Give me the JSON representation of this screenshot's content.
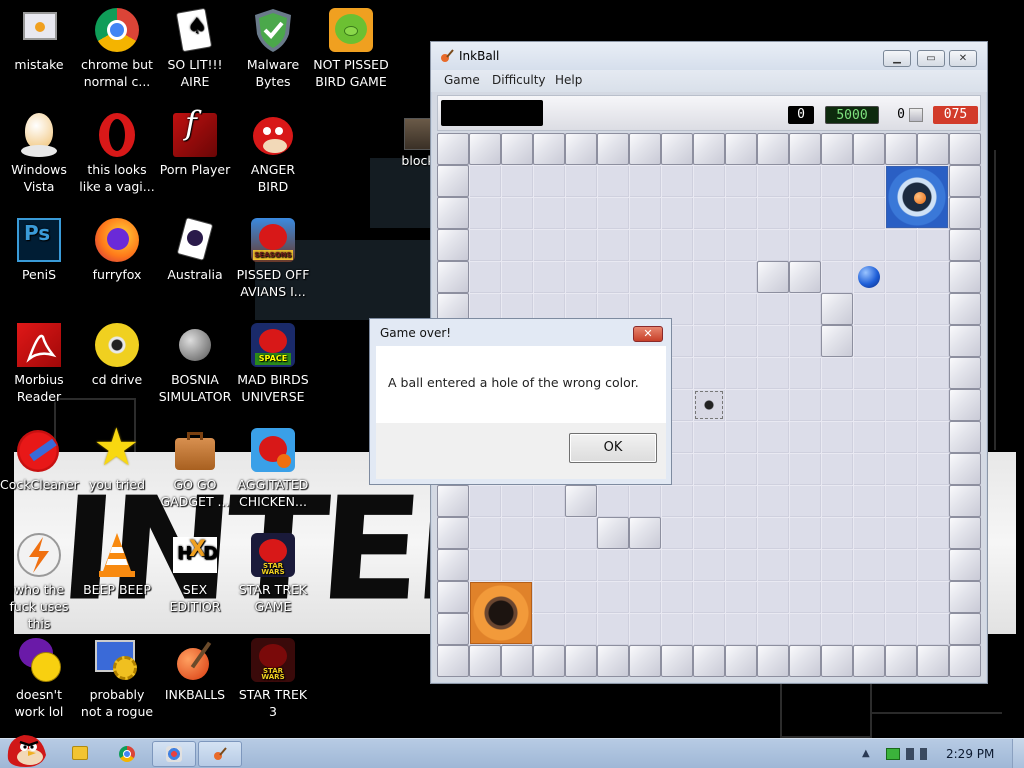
{
  "desktop": {
    "icons": [
      {
        "label": "mistake",
        "icon": "computer-icon"
      },
      {
        "label": "chrome but normal c...",
        "icon": "chrome-icon"
      },
      {
        "label": "SO LIT!!! AIRE",
        "icon": "solitaire-icon"
      },
      {
        "label": "Malware Bytes",
        "icon": "shield-icon"
      },
      {
        "label": "NOT PISSED BIRD GAME",
        "icon": "green-pig-icon"
      },
      {
        "label": "Windows Vista",
        "icon": "egg-icon"
      },
      {
        "label": "this looks like a vagi...",
        "icon": "opera-icon"
      },
      {
        "label": "Porn Player",
        "icon": "flash-icon"
      },
      {
        "label": "ANGER BIRD",
        "icon": "red-bird-icon"
      },
      {
        "label": "PeniS",
        "icon": "photoshop-icon"
      },
      {
        "label": "furryfox",
        "icon": "firefox-icon"
      },
      {
        "label": "Australia",
        "icon": "spider-solitaire-icon"
      },
      {
        "label": "PISSED OFF AVIANS I...",
        "icon": "angry-birds-seasons-icon"
      },
      {
        "label": "Morbius Reader",
        "icon": "acrobat-icon"
      },
      {
        "label": "cd drive",
        "icon": "cd-icon"
      },
      {
        "label": "BOSNIA SIMULATOR",
        "icon": "mine-icon"
      },
      {
        "label": "MAD BIRDS UNIVERSE",
        "icon": "angry-birds-space-icon"
      },
      {
        "label": "CockCleaner",
        "icon": "ccleaner-icon"
      },
      {
        "label": "you tried",
        "icon": "star-icon"
      },
      {
        "label": "GO GO GADGET ...",
        "icon": "briefcase-icon"
      },
      {
        "label": "AGGITATED CHICKEN...",
        "icon": "angry-birds-rio-icon"
      },
      {
        "label": "who the fuck uses this",
        "icon": "lightning-icon"
      },
      {
        "label": "BEEP BEEP",
        "icon": "vlc-cone-icon"
      },
      {
        "label": "SEX EDITIOR",
        "icon": "hxd-icon"
      },
      {
        "label": "STAR TREK GAME",
        "icon": "star-wars-birds-icon"
      },
      {
        "label": "doesn't work lol",
        "icon": "yahoo-messenger-icon"
      },
      {
        "label": "probably not a rogue",
        "icon": "gear-monitor-icon"
      },
      {
        "label": "INKBALLS",
        "icon": "inkball-icon"
      },
      {
        "label": "STAR TREK 3",
        "icon": "star-wars-birds-2-icon"
      }
    ],
    "partial_icon_label": "block"
  },
  "inkball": {
    "title": "InkBall",
    "menu": [
      "Game",
      "Difficulty",
      "Help"
    ],
    "scores": {
      "score": "0",
      "bonus": "5000",
      "balls": "0",
      "time": "075"
    },
    "colors": {
      "timer_bg": "#d23b2a",
      "bonus_bg": "#0e2a0e",
      "bonus_fg": "#7ee27e",
      "blue_hole": "#2f6fd6",
      "orange_hole": "#f0892e",
      "blue_ball": "#1f5fd8"
    }
  },
  "dialog": {
    "title": "Game over!",
    "message": "A ball entered a hole of the wrong color.",
    "ok_label": "OK",
    "close_glyph": "✕"
  },
  "window_controls": {
    "minimize": "▁",
    "maximize": "▭",
    "close": "✕"
  },
  "taskbar": {
    "clock": "2:29 PM",
    "pinned": [
      "explorer-icon",
      "chrome-icon",
      "paint-icon",
      "inkball-icon"
    ]
  }
}
